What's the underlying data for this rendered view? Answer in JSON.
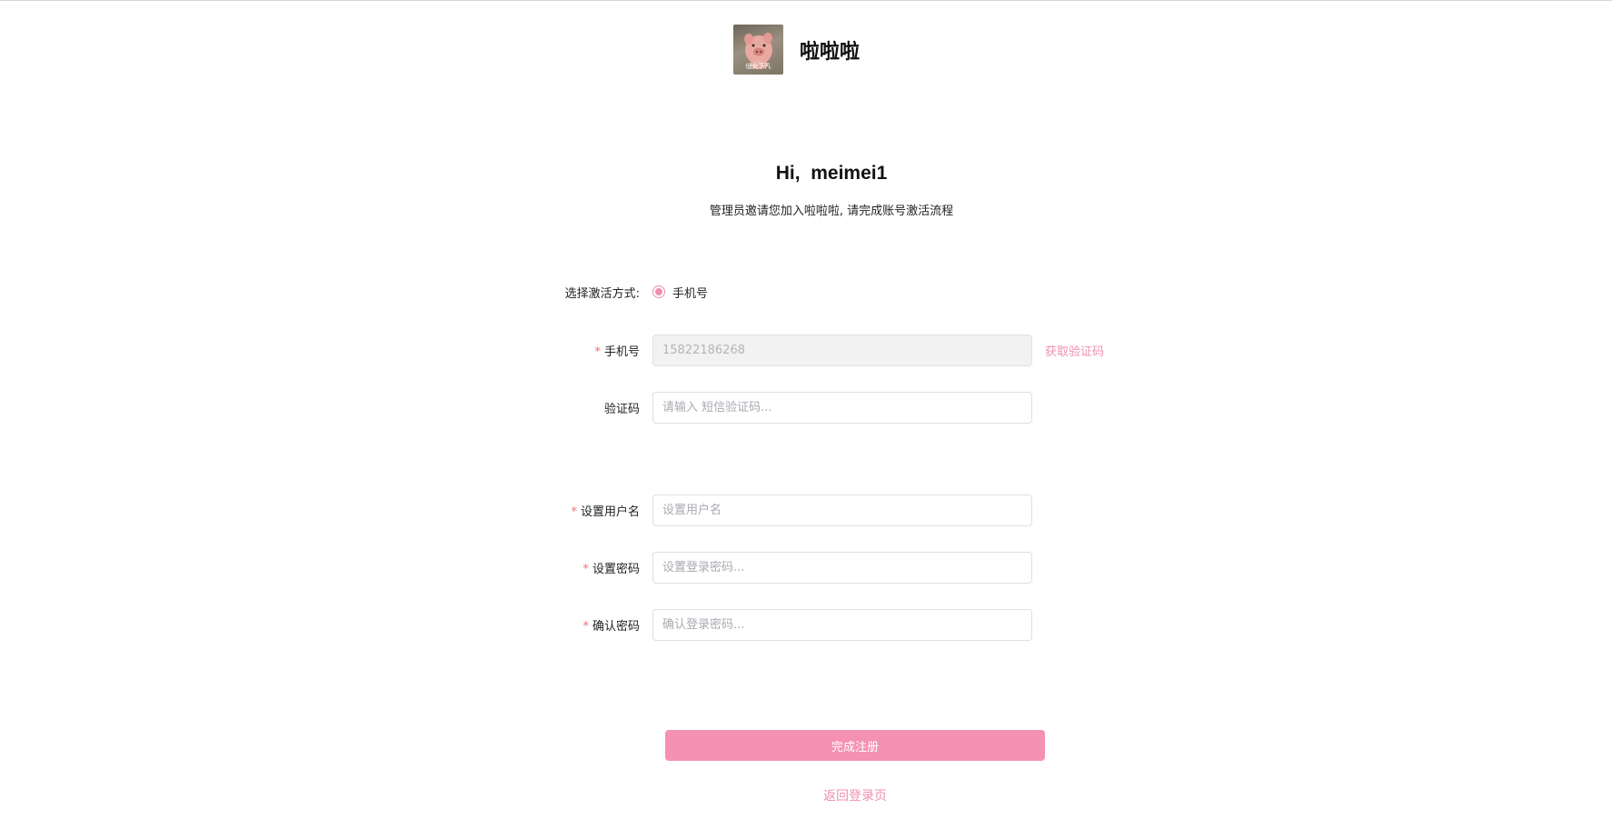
{
  "header": {
    "logo_icon": "pig-avatar-icon",
    "logo_caption": "仙女下凡",
    "brand_name": "啦啦啦"
  },
  "greeting": {
    "title": "Hi,  meimei1",
    "subtitle": "管理员邀请您加入啦啦啦, 请完成账号激活流程"
  },
  "form": {
    "activation_method": {
      "label": "选择激活方式:",
      "option_label": "手机号",
      "selected": true
    },
    "phone": {
      "label": "手机号",
      "required_mark": "*",
      "value": "15822186268",
      "get_code_label": "获取验证码"
    },
    "code": {
      "label": "验证码",
      "placeholder": "请输入 短信验证码..."
    },
    "username": {
      "label": "设置用户名",
      "required_mark": "*",
      "placeholder": "设置用户名"
    },
    "password": {
      "label": "设置密码",
      "required_mark": "*",
      "placeholder": "设置登录密码..."
    },
    "confirm_password": {
      "label": "确认密码",
      "required_mark": "*",
      "placeholder": "确认登录密码..."
    },
    "submit_label": "完成注册",
    "back_label": "返回登录页"
  },
  "colors": {
    "accent": "#f591b3",
    "link": "#f08fb0",
    "required": "#f56c6c"
  }
}
